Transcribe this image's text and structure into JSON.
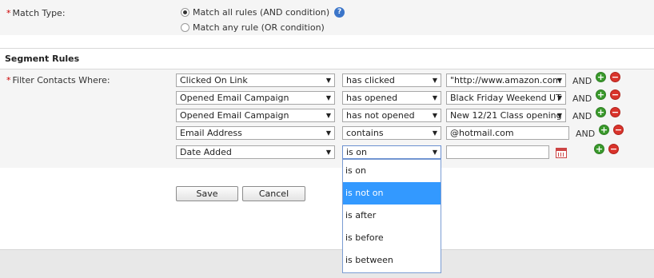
{
  "match": {
    "label": "Match Type:",
    "required_mark": "*",
    "options": [
      {
        "label": "Match all rules (AND condition)",
        "checked": true
      },
      {
        "label": "Match any rule (OR condition)",
        "checked": false
      }
    ],
    "help_icon": "question-icon"
  },
  "segment": {
    "title": "Segment Rules",
    "filter_label": "Filter Contacts Where:",
    "required_mark": "*",
    "rules": [
      {
        "field": "Clicked On Link",
        "operator": "has clicked",
        "value": "\"http://www.amazon.com",
        "conj": "AND"
      },
      {
        "field": "Opened Email Campaign",
        "operator": "has opened",
        "value": "Black Friday Weekend UT",
        "conj": "AND"
      },
      {
        "field": "Opened Email Campaign",
        "operator": "has not opened",
        "value": "New 12/21 Class opening",
        "conj": "AND"
      },
      {
        "field": "Email Address",
        "operator": "contains",
        "value": "@hotmail.com",
        "conj": "AND"
      },
      {
        "field": "Date Added",
        "operator": "is on",
        "value": "",
        "conj": ""
      }
    ],
    "dropdown_options": [
      "is on",
      "is not on",
      "is after",
      "is before",
      "is between"
    ],
    "dropdown_highlighted": "is not on"
  },
  "buttons": {
    "save": "Save",
    "cancel": "Cancel"
  },
  "icons": {
    "add": "plus-circle-icon",
    "remove": "minus-circle-icon",
    "calendar": "calendar-icon"
  },
  "colors": {
    "add": "#3a9a2c",
    "remove": "#d9332b",
    "highlight": "#3399ff",
    "required": "#cc0000"
  }
}
